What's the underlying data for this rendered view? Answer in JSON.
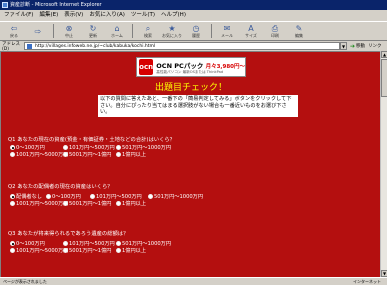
{
  "window": {
    "title": "資産診断 - Microsoft Internet Explorer"
  },
  "menu": [
    "ファイル(F)",
    "編集(E)",
    "表示(V)",
    "お気に入り(A)",
    "ツール(T)",
    "ヘルプ(H)"
  ],
  "toolbar": [
    {
      "label": "戻る",
      "icon": "back-icon"
    },
    {
      "label": "",
      "icon": "forward-icon"
    },
    {
      "label": "中止",
      "icon": "stop-icon"
    },
    {
      "label": "更新",
      "icon": "refresh-icon"
    },
    {
      "label": "ホーム",
      "icon": "home-icon"
    },
    {
      "label": "検索",
      "icon": "search-icon"
    },
    {
      "label": "お気に入り",
      "icon": "favorites-icon"
    },
    {
      "label": "履歴",
      "icon": "history-icon"
    },
    {
      "label": "メール",
      "icon": "mail-icon"
    },
    {
      "label": "サイズ",
      "icon": "size-icon"
    },
    {
      "label": "印刷",
      "icon": "print-icon"
    },
    {
      "label": "編集",
      "icon": "edit-icon"
    }
  ],
  "address": {
    "label": "アドレス(D)",
    "url": "http://villages.infoweb.ne.jp/~club/kabuka/kochi.html",
    "go_label": "移動",
    "links_label": "リンク"
  },
  "banner": {
    "logo": "ocn",
    "title": "OCN PCパック",
    "price": "月々3,980円〜",
    "subtitle": "高性能パソコン 最新OSまたは ThinkPad"
  },
  "page": {
    "title": "出題目チェック！",
    "instructions": "以下の質問に答えたあと、一番下の「簡易判定してみる」ボタンをクリックして下さい。自分にぴったり当てはまる選択肢がない場合も一番近いものをお選び下さい。"
  },
  "questions": [
    {
      "label": "Q1 あなたの現在の資産(預金・有価証券・土地などの合計)はいくら？",
      "rows": [
        [
          "0〜100万円",
          "101万円〜500万円",
          "501万円〜1000万円"
        ],
        [
          "1001万円〜5000万円",
          "5001万円〜1億円",
          "1億円以上"
        ]
      ],
      "selected": 0
    },
    {
      "label": "Q2 あなたの配偶者の現在の資産はいくら？",
      "rows": [
        [
          "配偶者なし",
          "0〜100万円",
          "101万円〜500万円",
          "501万円〜1000万円"
        ],
        [
          "1001万円〜5000万円",
          "5001万円〜1億円",
          "1億円以上"
        ]
      ],
      "selected": 0
    },
    {
      "label": "Q3 あなたが将来得られるであろう遺産の総額は？",
      "rows": [
        [
          "0〜100万円",
          "101万円〜500万円",
          "501万円〜1000万円"
        ],
        [
          "1001万円〜5000万円",
          "5001万円〜1億円",
          "1億円以上"
        ]
      ],
      "selected": 0
    }
  ],
  "status": {
    "left": "ページが表示されました",
    "right": "インターネット"
  },
  "colors": {
    "page_bg": "#b40f0f",
    "title": "#ffff00",
    "titlebar": "#0a246a"
  }
}
